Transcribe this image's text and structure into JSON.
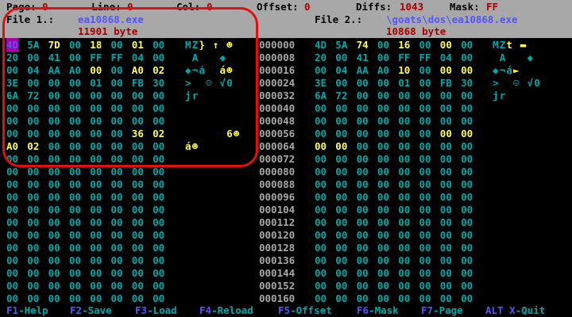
{
  "status": {
    "page_label": "Page:",
    "page_val": "0",
    "line_label": "Line:",
    "line_val": "0",
    "col_label": "Col:",
    "col_val": "0",
    "offset_label": "Offset:",
    "offset_val": "0",
    "diffs_label": "Diffs:",
    "diffs_val": "1043",
    "mask_label": "Mask:",
    "mask_val": "FF"
  },
  "file1": {
    "label": "File 1.:",
    "name": "ea10868.exe",
    "size": "11901 byte"
  },
  "file2": {
    "label": "File 2.:",
    "name": "\\goats\\dos\\ea10868.exe",
    "size": "10868 byte"
  },
  "offsets": [
    "000000",
    "000008",
    "000016",
    "000024",
    "000032",
    "000040",
    "000048",
    "000056",
    "000064",
    "000072",
    "000080",
    "000088",
    "000096",
    "000104",
    "000112",
    "000120",
    "000128",
    "000136",
    "000144",
    "000152",
    "000160"
  ],
  "left_rows": [
    [
      "4D",
      "5A",
      "7D",
      "00",
      "18",
      "00",
      "01",
      "00"
    ],
    [
      "20",
      "00",
      "41",
      "00",
      "FF",
      "FF",
      "04",
      "00"
    ],
    [
      "00",
      "04",
      "AA",
      "A0",
      "00",
      "00",
      "A0",
      "02"
    ],
    [
      "3E",
      "00",
      "00",
      "00",
      "01",
      "00",
      "FB",
      "30"
    ],
    [
      "6A",
      "72",
      "00",
      "00",
      "00",
      "00",
      "00",
      "00"
    ],
    [
      "00",
      "00",
      "00",
      "00",
      "00",
      "00",
      "00",
      "00"
    ],
    [
      "00",
      "00",
      "00",
      "00",
      "00",
      "00",
      "00",
      "00"
    ],
    [
      "00",
      "00",
      "00",
      "00",
      "00",
      "00",
      "36",
      "02"
    ],
    [
      "A0",
      "02",
      "00",
      "00",
      "00",
      "00",
      "00",
      "00"
    ],
    [
      "00",
      "00",
      "00",
      "00",
      "00",
      "00",
      "00",
      "00"
    ],
    [
      "00",
      "00",
      "00",
      "00",
      "00",
      "00",
      "00",
      "00"
    ],
    [
      "00",
      "00",
      "00",
      "00",
      "00",
      "00",
      "00",
      "00"
    ],
    [
      "00",
      "00",
      "00",
      "00",
      "00",
      "00",
      "00",
      "00"
    ],
    [
      "00",
      "00",
      "00",
      "00",
      "00",
      "00",
      "00",
      "00"
    ],
    [
      "00",
      "00",
      "00",
      "00",
      "00",
      "00",
      "00",
      "00"
    ],
    [
      "00",
      "00",
      "00",
      "00",
      "00",
      "00",
      "00",
      "00"
    ],
    [
      "00",
      "00",
      "00",
      "00",
      "00",
      "00",
      "00",
      "00"
    ],
    [
      "00",
      "00",
      "00",
      "00",
      "00",
      "00",
      "00",
      "00"
    ],
    [
      "00",
      "00",
      "00",
      "00",
      "00",
      "00",
      "00",
      "00"
    ],
    [
      "00",
      "00",
      "00",
      "00",
      "00",
      "00",
      "00",
      "00"
    ],
    [
      "00",
      "00",
      "00",
      "00",
      "00",
      "00",
      "00",
      "00"
    ]
  ],
  "left_hl": [
    [
      0,
      0,
      1,
      0,
      1,
      0,
      1,
      0
    ],
    [
      0,
      0,
      0,
      0,
      0,
      0,
      0,
      0
    ],
    [
      0,
      0,
      0,
      0,
      1,
      0,
      1,
      1
    ],
    [
      0,
      0,
      0,
      0,
      0,
      0,
      0,
      0
    ],
    [
      0,
      0,
      0,
      0,
      0,
      0,
      0,
      0
    ],
    [
      0,
      0,
      0,
      0,
      0,
      0,
      0,
      0
    ],
    [
      0,
      0,
      0,
      0,
      0,
      0,
      0,
      0
    ],
    [
      0,
      0,
      0,
      0,
      0,
      0,
      1,
      1
    ],
    [
      1,
      1,
      0,
      0,
      0,
      0,
      0,
      0
    ]
  ],
  "left_ascii": [
    "MZ} ↑ ☻",
    " A   ◆",
    "◆¬á  á☻",
    ">  ☺ √0",
    "jr",
    "",
    "",
    "      6☻",
    "á☻"
  ],
  "left_ascii_hl": [
    [
      0,
      0,
      1,
      0,
      1,
      0,
      1,
      0
    ],
    [],
    [
      0,
      0,
      0,
      0,
      0,
      1,
      1,
      0
    ],
    [],
    [],
    [],
    [],
    [
      0,
      0,
      0,
      0,
      0,
      0,
      1,
      1
    ],
    [
      1,
      1,
      0,
      0,
      0,
      0,
      0,
      0
    ]
  ],
  "right_rows": [
    [
      "4D",
      "5A",
      "74",
      "00",
      "16",
      "00",
      "00",
      "00"
    ],
    [
      "20",
      "00",
      "41",
      "00",
      "FF",
      "FF",
      "04",
      "00"
    ],
    [
      "00",
      "04",
      "AA",
      "A0",
      "10",
      "00",
      "00",
      "00"
    ],
    [
      "3E",
      "00",
      "00",
      "00",
      "01",
      "00",
      "FB",
      "30"
    ],
    [
      "6A",
      "72",
      "00",
      "00",
      "00",
      "00",
      "00",
      "00"
    ],
    [
      "00",
      "00",
      "00",
      "00",
      "00",
      "00",
      "00",
      "00"
    ],
    [
      "00",
      "00",
      "00",
      "00",
      "00",
      "00",
      "00",
      "00"
    ],
    [
      "00",
      "00",
      "00",
      "00",
      "00",
      "00",
      "00",
      "00"
    ],
    [
      "00",
      "00",
      "00",
      "00",
      "00",
      "00",
      "00",
      "00"
    ],
    [
      "00",
      "00",
      "00",
      "00",
      "00",
      "00",
      "00",
      "00"
    ],
    [
      "00",
      "00",
      "00",
      "00",
      "00",
      "00",
      "00",
      "00"
    ],
    [
      "00",
      "00",
      "00",
      "00",
      "00",
      "00",
      "00",
      "00"
    ],
    [
      "00",
      "00",
      "00",
      "00",
      "00",
      "00",
      "00",
      "00"
    ],
    [
      "00",
      "00",
      "00",
      "00",
      "00",
      "00",
      "00",
      "00"
    ],
    [
      "00",
      "00",
      "00",
      "00",
      "00",
      "00",
      "00",
      "00"
    ],
    [
      "00",
      "00",
      "00",
      "00",
      "00",
      "00",
      "00",
      "00"
    ],
    [
      "00",
      "00",
      "00",
      "00",
      "00",
      "00",
      "00",
      "00"
    ],
    [
      "00",
      "00",
      "00",
      "00",
      "00",
      "00",
      "00",
      "00"
    ],
    [
      "00",
      "00",
      "00",
      "00",
      "00",
      "00",
      "00",
      "00"
    ],
    [
      "00",
      "00",
      "00",
      "00",
      "00",
      "00",
      "00",
      "00"
    ],
    [
      "00",
      "00",
      "00",
      "00",
      "00",
      "00",
      "00",
      "00"
    ]
  ],
  "right_hl": [
    [
      0,
      0,
      1,
      0,
      1,
      0,
      1,
      0
    ],
    [
      0,
      0,
      0,
      0,
      0,
      0,
      0,
      0
    ],
    [
      0,
      0,
      0,
      0,
      1,
      0,
      1,
      1
    ],
    [
      0,
      0,
      0,
      0,
      0,
      0,
      0,
      0
    ],
    [
      0,
      0,
      0,
      0,
      0,
      0,
      0,
      0
    ],
    [
      0,
      0,
      0,
      0,
      0,
      0,
      0,
      0
    ],
    [
      0,
      0,
      0,
      0,
      0,
      0,
      0,
      0
    ],
    [
      0,
      0,
      0,
      0,
      0,
      0,
      1,
      1
    ],
    [
      1,
      1,
      0,
      0,
      0,
      0,
      0,
      0
    ]
  ],
  "right_ascii": [
    "MZt ▬",
    " A   ◆",
    "◆¬á►",
    ">  ☺ √0",
    "jr",
    "",
    "",
    "",
    ""
  ],
  "right_ascii_hl": [
    [
      0,
      0,
      1,
      0,
      1
    ],
    [],
    [
      0,
      0,
      0,
      1
    ],
    [],
    [],
    [],
    [],
    [],
    []
  ],
  "fkeys": [
    {
      "key": "F1",
      "label": "-Help"
    },
    {
      "key": "F2",
      "label": "-Save"
    },
    {
      "key": "F3",
      "label": "-Load"
    },
    {
      "key": "F4",
      "label": "-Reload"
    },
    {
      "key": "F5",
      "label": "-Offset"
    },
    {
      "key": "F6",
      "label": "-Mask"
    },
    {
      "key": "F7",
      "label": "-Page"
    },
    {
      "key": "ALT X",
      "label": "-Quit"
    }
  ],
  "colors": {
    "background": "#a8a8a8",
    "hex": "#00a8a8",
    "diff": "#fcfc54",
    "label": "#a80000",
    "name": "#5454fc",
    "cursor": "#a800a8",
    "annotation": "#e01010"
  }
}
